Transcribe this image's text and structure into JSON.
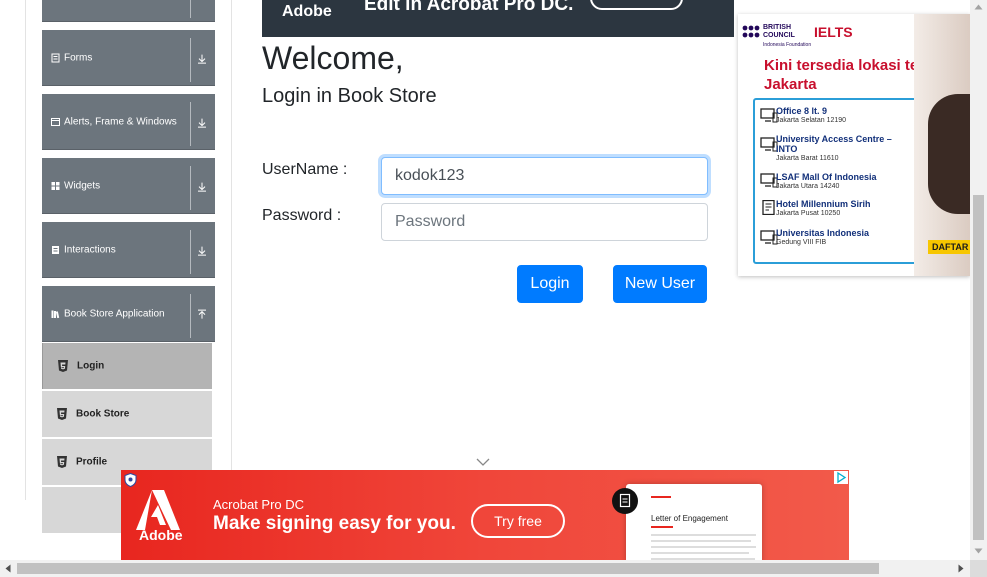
{
  "sidebar": {
    "groups": [
      {
        "label": "",
        "icon": "collapsed-group-icon"
      },
      {
        "label": "Forms",
        "icon": "form-icon"
      },
      {
        "label": "Alerts, Frame & Windows",
        "icon": "window-icon"
      },
      {
        "label": "Widgets",
        "icon": "grid-icon"
      },
      {
        "label": "Interactions",
        "icon": "interaction-icon"
      },
      {
        "label": "Book Store Application",
        "icon": "book-icon"
      }
    ],
    "items": [
      {
        "label": "Login",
        "icon": "html5-icon",
        "active": true
      },
      {
        "label": "Book Store",
        "icon": "html5-icon",
        "active": false
      },
      {
        "label": "Profile",
        "icon": "html5-icon",
        "active": false
      }
    ]
  },
  "top_ad": {
    "brand": "Adobe",
    "headline": "Edit in Acrobat Pro DC."
  },
  "login": {
    "title": "Welcome,",
    "subtitle": "Login in Book Store",
    "username_label": "UserName :",
    "username_value": "kodok123",
    "password_label": "Password :",
    "password_placeholder": "Password",
    "login_button": "Login",
    "new_user_button": "New User"
  },
  "right_ad": {
    "org": "BRITISH COUNCIL",
    "brand": "IELTS",
    "foundation": "Indonesia Foundation",
    "headline": "Kini tersedia lokasi test di Jakarta",
    "cta": "DAFTAR",
    "locations": [
      {
        "name": "Office 8 lt. 9",
        "sub": "Jakarta Selatan 12190"
      },
      {
        "name": "University Access Centre – INTO",
        "sub": "Jakarta Barat 11610"
      },
      {
        "name": "LSAF Mall Of Indonesia",
        "sub": "Jakarta Utara 14240"
      },
      {
        "name": "Hotel Millennium Sirih",
        "sub": "Jakarta Pusat 10250"
      },
      {
        "name": "Universitas Indonesia",
        "sub": "Gedung VIII FIB"
      }
    ]
  },
  "bottom_ad": {
    "brand": "Adobe",
    "product": "Acrobat Pro DC",
    "tagline": "Make signing easy for you.",
    "cta": "Try free",
    "doc_title": "Letter of Engagement"
  },
  "colors": {
    "primary": "#007bff",
    "sidebar": "#6c757d",
    "acrobat_red": "#e8261f",
    "ielts_red": "#c8102e"
  }
}
